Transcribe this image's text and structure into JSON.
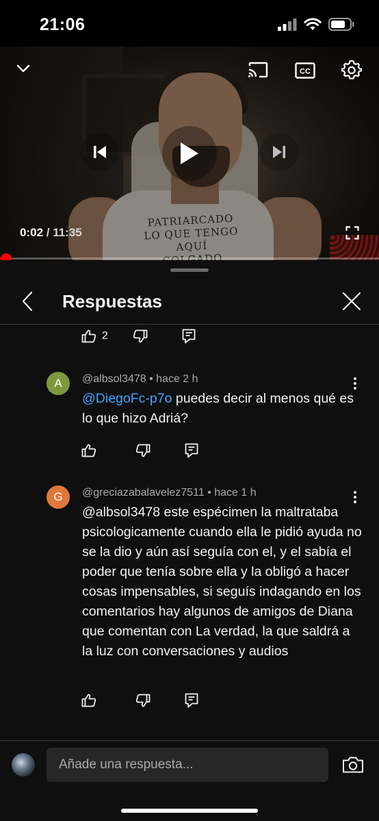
{
  "status_bar": {
    "time": "21:06"
  },
  "player": {
    "current_time": "0:02",
    "separator": " / ",
    "duration": "11:35",
    "progress": 0.003,
    "shirt_text": [
      "PATRIARCADO",
      "LO QUE TENGO AQUÍ",
      "COLGADO"
    ],
    "icons": [
      "chevron-down-icon",
      "cast-icon",
      "captions-icon",
      "settings-icon",
      "previous-icon",
      "play-icon",
      "next-icon",
      "fullscreen-icon"
    ]
  },
  "panel": {
    "title": "Respuestas",
    "prev_actions": {
      "like_count": "2"
    }
  },
  "comments": [
    {
      "avatar_letter": "A",
      "avatar_color": "#7b9a3c",
      "author": "@albsol3478",
      "time": "hace 2 h",
      "mention": "@DiegoFc-p7o",
      "text": " puedes decir al menos qué es lo que hizo Adriá?"
    },
    {
      "avatar_letter": "G",
      "avatar_color": "#e0783a",
      "author": "@greciazabalavelez7511",
      "time": "hace 1 h",
      "text": "@albsol3478 este espécimen la maltrataba psicologicamente  cuando ella le pidió ayuda no se la dio y aún así seguía con el, y el sabía el poder que tenía sobre ella y la obligó a hacer cosas impensables, si seguís indagando en los comentarios hay algunos de amigos de Diana que comentan con La verdad, la que saldrá a la luz con conversaciones y audios"
    }
  ],
  "reply_bar": {
    "placeholder": "Añade una respuesta..."
  },
  "colors": {
    "accent_red": "#ff0000",
    "mention_blue": "#3ea6ff",
    "background": "#0f0f0f"
  }
}
